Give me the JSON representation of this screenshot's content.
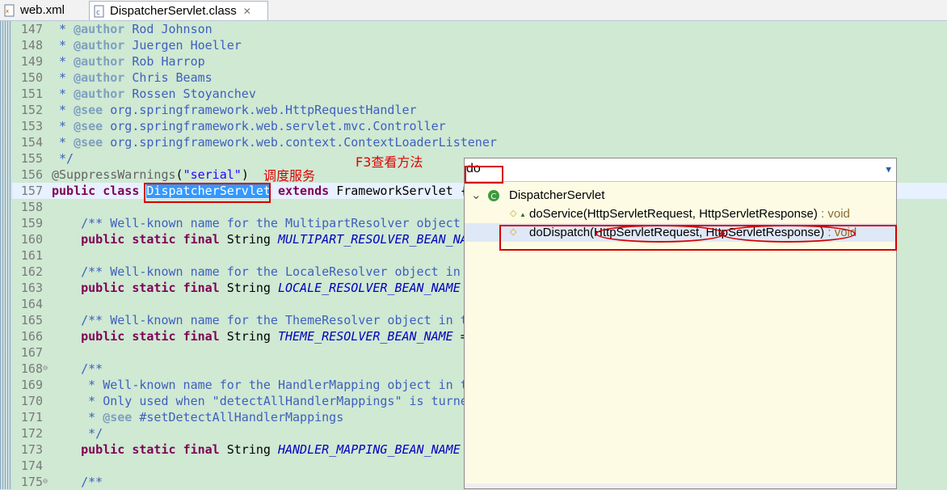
{
  "tabs": [
    {
      "label": "web.xml",
      "icon": "xml-file-icon",
      "active": false
    },
    {
      "label": "DispatcherServlet.class",
      "icon": "class-file-icon",
      "active": true,
      "close": "✕"
    }
  ],
  "code_lines": [
    {
      "n": "147",
      "segs": [
        {
          "t": " * ",
          "c": "c"
        },
        {
          "t": "@author",
          "c": "tag"
        },
        {
          "t": " Rod Johnson",
          "c": "c"
        }
      ]
    },
    {
      "n": "148",
      "segs": [
        {
          "t": " * ",
          "c": "c"
        },
        {
          "t": "@author",
          "c": "tag"
        },
        {
          "t": " Juergen Hoeller",
          "c": "c"
        }
      ]
    },
    {
      "n": "149",
      "segs": [
        {
          "t": " * ",
          "c": "c"
        },
        {
          "t": "@author",
          "c": "tag"
        },
        {
          "t": " Rob Harrop",
          "c": "c"
        }
      ]
    },
    {
      "n": "150",
      "segs": [
        {
          "t": " * ",
          "c": "c"
        },
        {
          "t": "@author",
          "c": "tag"
        },
        {
          "t": " Chris Beams",
          "c": "c"
        }
      ]
    },
    {
      "n": "151",
      "segs": [
        {
          "t": " * ",
          "c": "c"
        },
        {
          "t": "@author",
          "c": "tag"
        },
        {
          "t": " Rossen Stoyanchev",
          "c": "c"
        }
      ]
    },
    {
      "n": "152",
      "segs": [
        {
          "t": " * ",
          "c": "c"
        },
        {
          "t": "@see",
          "c": "tag"
        },
        {
          "t": " org.springframework.web.HttpRequestHandler",
          "c": "c"
        }
      ]
    },
    {
      "n": "153",
      "segs": [
        {
          "t": " * ",
          "c": "c"
        },
        {
          "t": "@see",
          "c": "tag"
        },
        {
          "t": " org.springframework.web.servlet.mvc.Controller",
          "c": "c"
        }
      ]
    },
    {
      "n": "154",
      "segs": [
        {
          "t": " * ",
          "c": "c"
        },
        {
          "t": "@see",
          "c": "tag"
        },
        {
          "t": " org.springframework.web.context.ContextLoaderListener",
          "c": "c"
        }
      ]
    },
    {
      "n": "155",
      "segs": [
        {
          "t": " */",
          "c": "c"
        }
      ]
    },
    {
      "n": "156",
      "segs": [
        {
          "t": "@SuppressWarnings",
          "c": "ann"
        },
        {
          "t": "(",
          "c": ""
        },
        {
          "t": "\"serial\"",
          "c": "str"
        },
        {
          "t": ")",
          "c": ""
        }
      ]
    },
    {
      "n": "157",
      "current": true,
      "segs": [
        {
          "t": "public",
          "c": "kw"
        },
        {
          "t": " ",
          "c": ""
        },
        {
          "t": "class",
          "c": "kw"
        },
        {
          "t": " ",
          "c": ""
        },
        {
          "t": "DispatcherServlet",
          "c": "sel"
        },
        {
          "t": " ",
          "c": ""
        },
        {
          "t": "extends",
          "c": "kw"
        },
        {
          "t": " FrameworkServlet {",
          "c": ""
        }
      ]
    },
    {
      "n": "158",
      "segs": []
    },
    {
      "n": "159",
      "segs": [
        {
          "t": "    /** Well-known name for the MultipartResolver object",
          "c": "c"
        }
      ]
    },
    {
      "n": "160",
      "segs": [
        {
          "t": "    ",
          "c": ""
        },
        {
          "t": "public",
          "c": "kw"
        },
        {
          "t": " ",
          "c": ""
        },
        {
          "t": "static",
          "c": "kw"
        },
        {
          "t": " ",
          "c": ""
        },
        {
          "t": "final",
          "c": "kw"
        },
        {
          "t": " String ",
          "c": ""
        },
        {
          "t": "MULTIPART_RESOLVER_BEAN_NA",
          "c": "fld"
        }
      ]
    },
    {
      "n": "161",
      "segs": []
    },
    {
      "n": "162",
      "segs": [
        {
          "t": "    /** Well-known name for the LocaleResolver object in",
          "c": "c"
        }
      ]
    },
    {
      "n": "163",
      "segs": [
        {
          "t": "    ",
          "c": ""
        },
        {
          "t": "public",
          "c": "kw"
        },
        {
          "t": " ",
          "c": ""
        },
        {
          "t": "static",
          "c": "kw"
        },
        {
          "t": " ",
          "c": ""
        },
        {
          "t": "final",
          "c": "kw"
        },
        {
          "t": " String ",
          "c": ""
        },
        {
          "t": "LOCALE_RESOLVER_BEAN_NAME",
          "c": "fld"
        }
      ]
    },
    {
      "n": "164",
      "segs": []
    },
    {
      "n": "165",
      "segs": [
        {
          "t": "    /** Well-known name for the ThemeResolver object in t",
          "c": "c"
        }
      ]
    },
    {
      "n": "166",
      "segs": [
        {
          "t": "    ",
          "c": ""
        },
        {
          "t": "public",
          "c": "kw"
        },
        {
          "t": " ",
          "c": ""
        },
        {
          "t": "static",
          "c": "kw"
        },
        {
          "t": " ",
          "c": ""
        },
        {
          "t": "final",
          "c": "kw"
        },
        {
          "t": " String ",
          "c": ""
        },
        {
          "t": "THEME_RESOLVER_BEAN_NAME",
          "c": "fld"
        },
        {
          "t": " =",
          "c": ""
        }
      ]
    },
    {
      "n": "167",
      "segs": []
    },
    {
      "n": "168",
      "fold": "⊖",
      "segs": [
        {
          "t": "    /**",
          "c": "c"
        }
      ]
    },
    {
      "n": "169",
      "segs": [
        {
          "t": "     * Well-known name for the HandlerMapping object in t",
          "c": "c"
        }
      ]
    },
    {
      "n": "170",
      "segs": [
        {
          "t": "     * Only used when \"detectAllHandlerMappings\" is turne",
          "c": "c"
        }
      ]
    },
    {
      "n": "171",
      "segs": [
        {
          "t": "     * ",
          "c": "c"
        },
        {
          "t": "@see",
          "c": "tag"
        },
        {
          "t": " #setDetectAllHandlerMappings",
          "c": "c"
        }
      ]
    },
    {
      "n": "172",
      "segs": [
        {
          "t": "     */",
          "c": "c"
        }
      ]
    },
    {
      "n": "173",
      "segs": [
        {
          "t": "    ",
          "c": ""
        },
        {
          "t": "public",
          "c": "kw"
        },
        {
          "t": " ",
          "c": ""
        },
        {
          "t": "static",
          "c": "kw"
        },
        {
          "t": " ",
          "c": ""
        },
        {
          "t": "final",
          "c": "kw"
        },
        {
          "t": " String ",
          "c": ""
        },
        {
          "t": "HANDLER_MAPPING_BEAN_NAME",
          "c": "fld"
        }
      ]
    },
    {
      "n": "174",
      "segs": []
    },
    {
      "n": "175",
      "fold": "⊖",
      "segs": [
        {
          "t": "    /**",
          "c": "c"
        }
      ]
    }
  ],
  "annotations": {
    "note_dispatch": "调度服务",
    "note_f3": "F3查看方法"
  },
  "popup": {
    "filter_value": "do",
    "menu_arrow": "▼",
    "tree": {
      "expander": "⌄",
      "class_icon": "class-icon",
      "class_name": "DispatcherServlet",
      "methods": [
        {
          "name": "doService",
          "params": "(HttpServletRequest, HttpServletResponse)",
          "type": " : void",
          "icon": "protected-method-icon",
          "selected": false
        },
        {
          "name": "doDispatch",
          "params": "(HttpServletRequest, HttpServletResponse)",
          "type": " : void",
          "icon": "protected-method-icon",
          "selected": true
        }
      ]
    }
  },
  "colors": {
    "editor_bg": "#cfe9d3",
    "popup_bg": "#fdfbe4",
    "annotation_red": "#d40000",
    "selection": "#3399ff"
  }
}
